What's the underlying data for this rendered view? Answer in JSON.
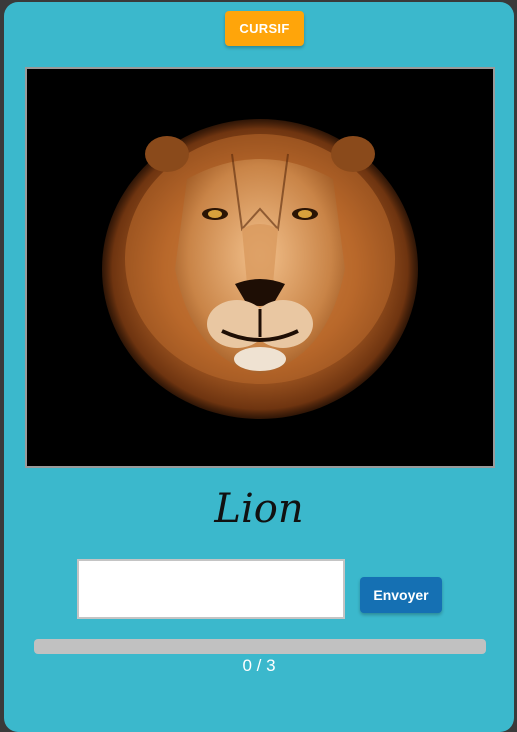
{
  "mode_button": {
    "label": "CURSIF"
  },
  "image": {
    "subject": "lion-face",
    "background_color": "#000000"
  },
  "word": {
    "text": "Lion"
  },
  "answer": {
    "value": "",
    "placeholder": ""
  },
  "submit_button": {
    "label": "Envoyer"
  },
  "progress": {
    "current": 0,
    "total": 3,
    "fraction": 0,
    "text": "0 / 3"
  },
  "colors": {
    "card": "#3bb8cc",
    "mode_button": "#ffa50a",
    "submit_button": "#1570b3",
    "progress_track": "#c1c1c1"
  }
}
